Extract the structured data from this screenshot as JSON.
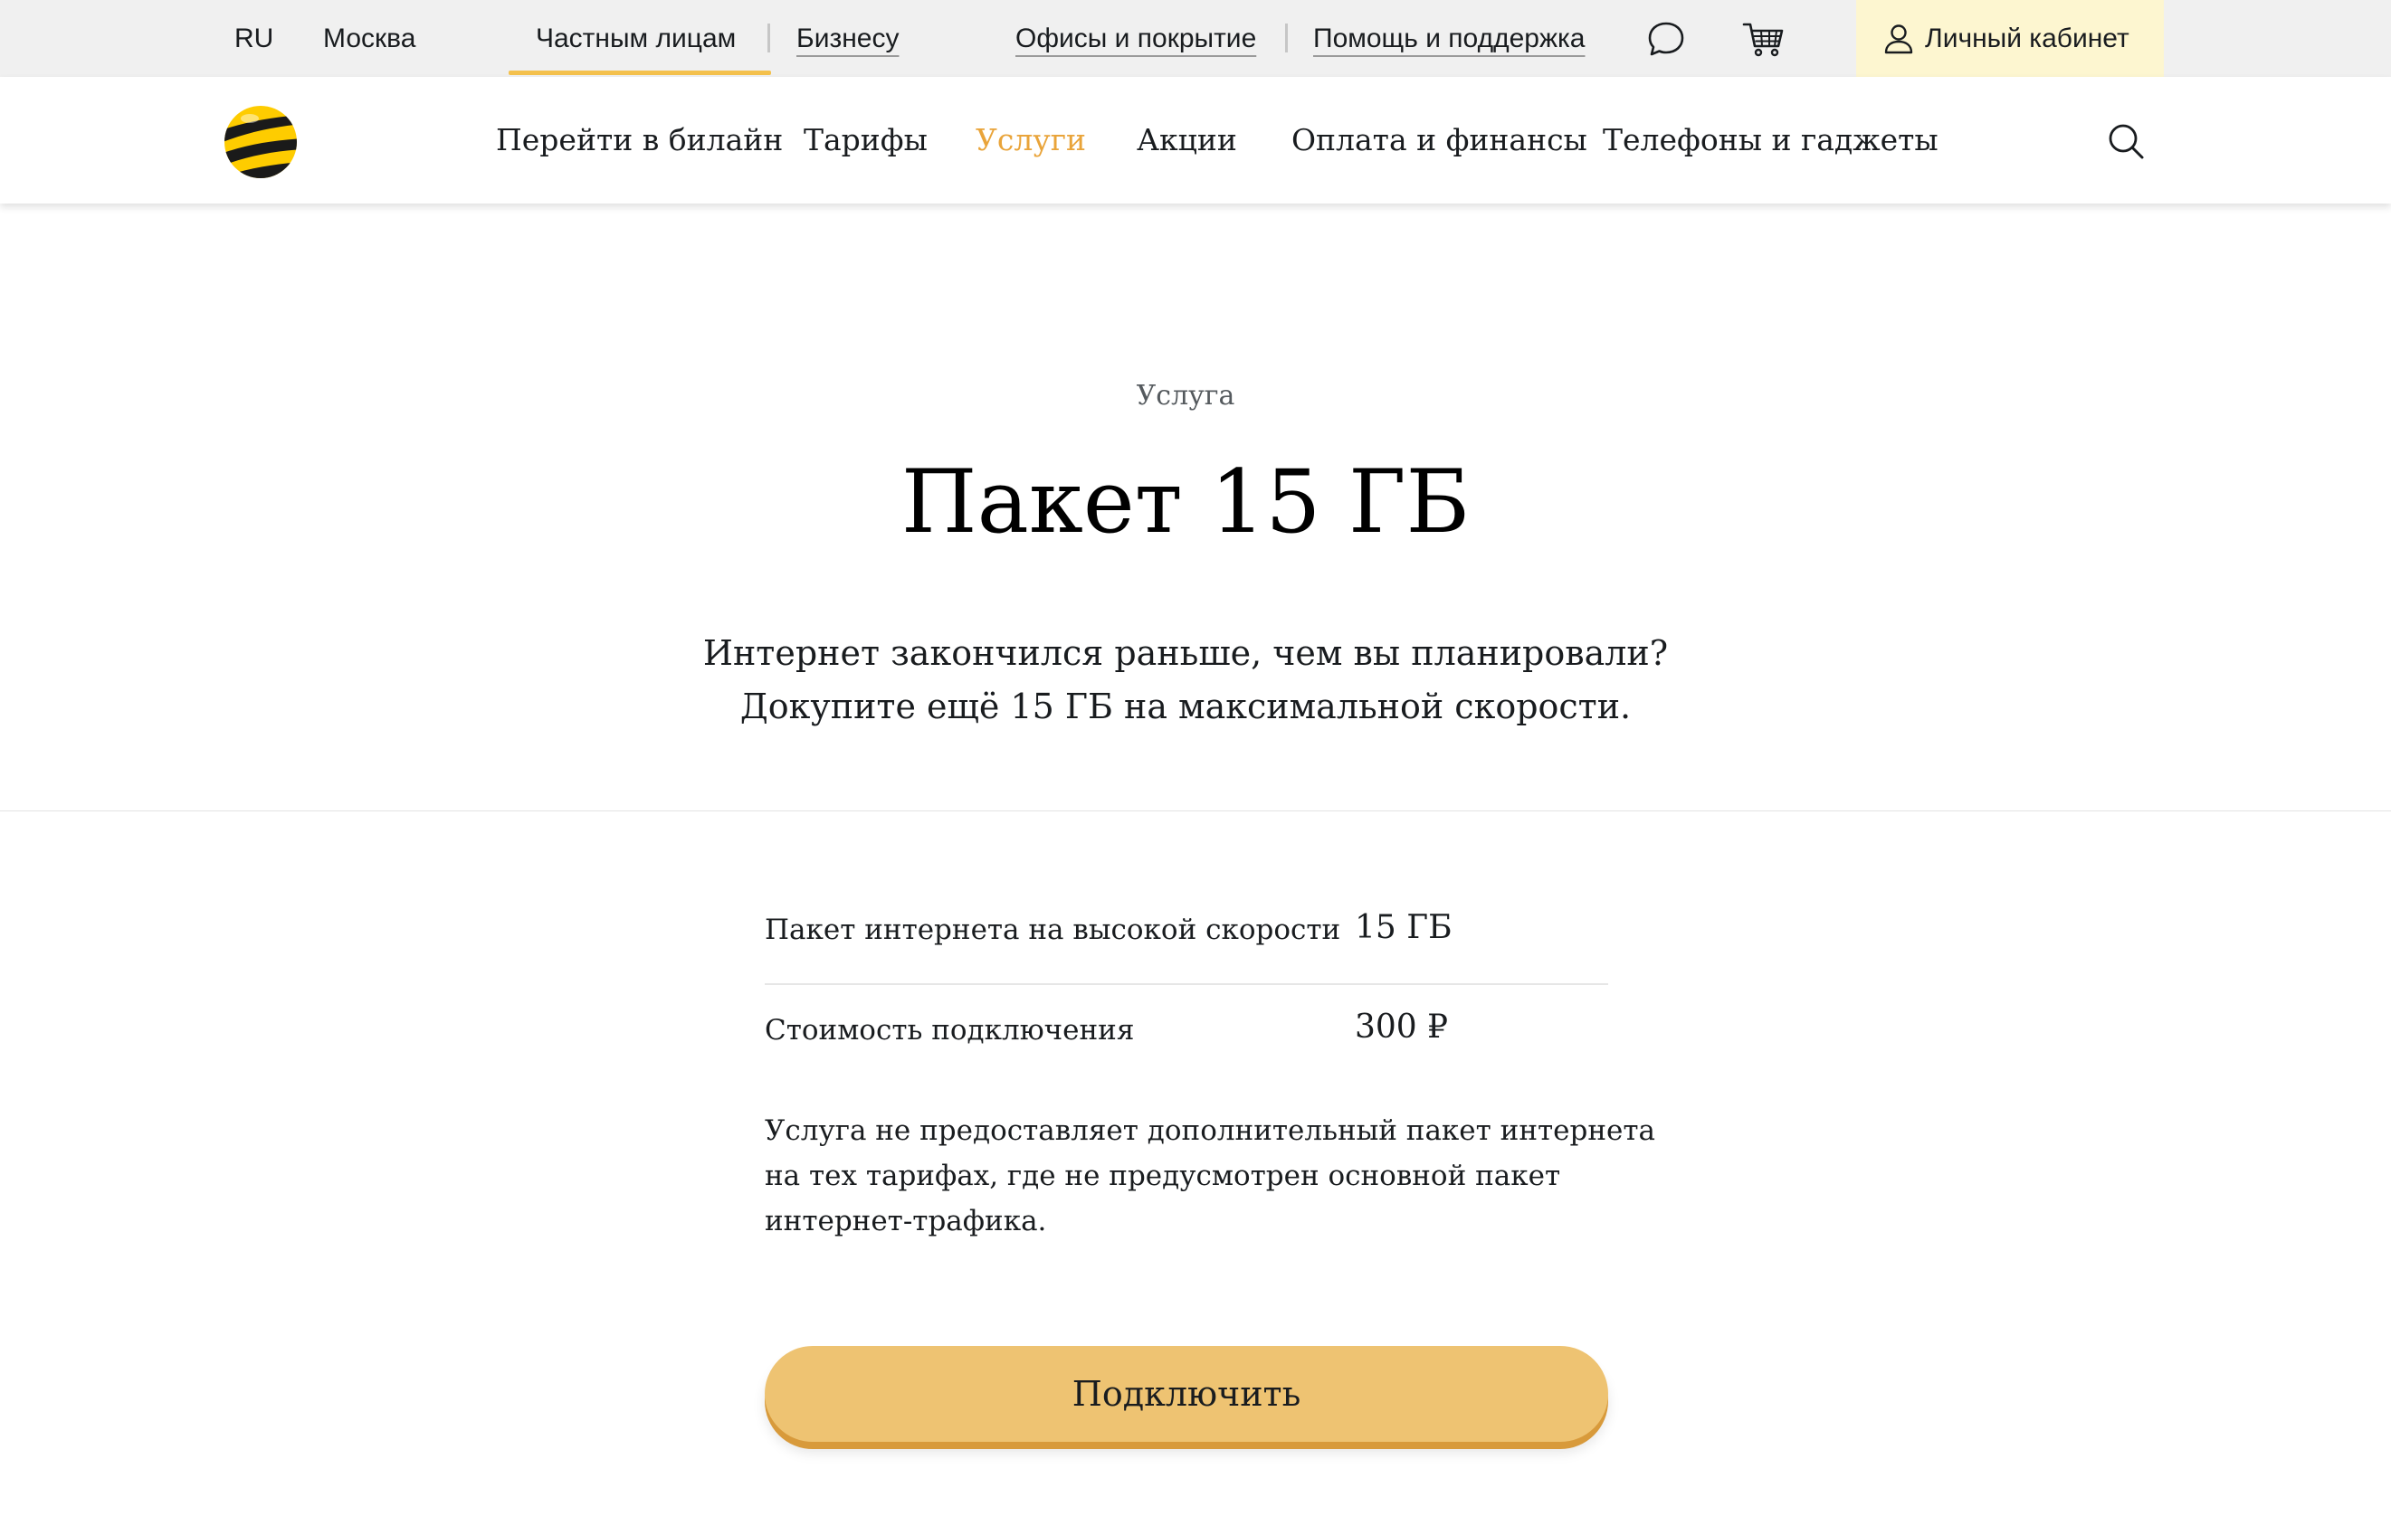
{
  "topbar": {
    "language": "RU",
    "city": "Москва",
    "segment_private": "Частным лицам",
    "segment_business": "Бизнесу",
    "offices_link": "Офисы и покрытие",
    "help_link": "Помощь и поддержка",
    "chat_icon": "chat-bubble-icon",
    "cart_icon": "shopping-cart-icon",
    "cabinet_label": "Личный кабинет"
  },
  "header": {
    "logo_icon": "beeline-logo",
    "nav": [
      "Перейти в билайн",
      "Тарифы",
      "Услуги",
      "Акции",
      "Оплата и финансы",
      "Телефоны и гаджеты"
    ],
    "active_nav": "Услуги",
    "search_icon": "search-icon"
  },
  "hero": {
    "eyebrow": "Услуга",
    "title": "Пакет 15 ГБ",
    "lead_line1": "Интернет закончился раньше, чем вы планировали?",
    "lead_line2": "Докупите ещё 15 ГБ на максимальной скорости."
  },
  "params": [
    {
      "label": "Пакет интернета на высокой скорости",
      "value": "15 ГБ"
    },
    {
      "label": "Стоимость подключения",
      "value": "300 ₽"
    }
  ],
  "note_lines": [
    "Услуга не предоставляет дополнительный пакет интернета",
    "на тех тарифах, где не предусмотрен основной пакет",
    "интернет-трафика."
  ],
  "cta_label": "Подключить",
  "colors": {
    "accent": "#f4c14d",
    "active_nav": "#e9a43a",
    "button": "#eec372",
    "cabinet_bg": "#fdf6d0",
    "topbar_bg": "#f0f0f0"
  }
}
